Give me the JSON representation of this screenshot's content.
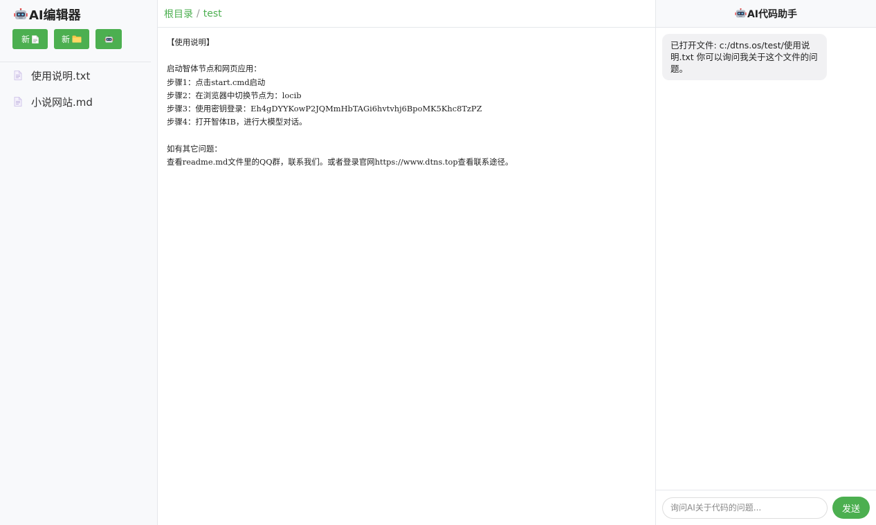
{
  "sidebar": {
    "title": "AI编辑器",
    "title_icon": "robot-icon",
    "toolbar": {
      "new_file_label": "新",
      "new_file_icon": "file-icon",
      "new_folder_label": "新",
      "new_folder_icon": "folder-icon",
      "ai_icon": "robot-icon"
    },
    "files": [
      {
        "name": "使用说明.txt",
        "icon": "file-text-icon"
      },
      {
        "name": "小说网站.md",
        "icon": "file-text-icon"
      }
    ]
  },
  "editor": {
    "breadcrumb": {
      "root": "根目录",
      "separator": "/",
      "current": "test"
    },
    "content": "【使用说明】\n\n启动智体节点和网页应用：\n步骤1：点击start.cmd启动\n步骤2：在浏览器中切换节点为：locib\n步骤3：使用密钥登录：Eh4gDYYKowP2JQMmHbTAGi6hvtvhj6BpoMK5Khc8TzPZ\n步骤4：打开智体IB，进行大模型对话。\n\n如有其它问题：\n查看readme.md文件里的QQ群，联系我们。或者登录官网https://www.dtns.top查看联系途径。"
  },
  "chat": {
    "title": "AI代码助手",
    "title_icon": "robot-icon",
    "messages": [
      {
        "role": "assistant",
        "text": "已打开文件: c:/dtns.os/test/使用说明.txt 你可以询问我关于这个文件的问题。"
      }
    ],
    "input": {
      "value": "",
      "placeholder": "询问AI关于代码的问题..."
    },
    "send_label": "发送"
  },
  "colors": {
    "accent": "#4caf50",
    "sidebar_bg": "#f8f9fb",
    "bubble_bg": "#f1f1f3",
    "border": "#e5e7eb"
  }
}
